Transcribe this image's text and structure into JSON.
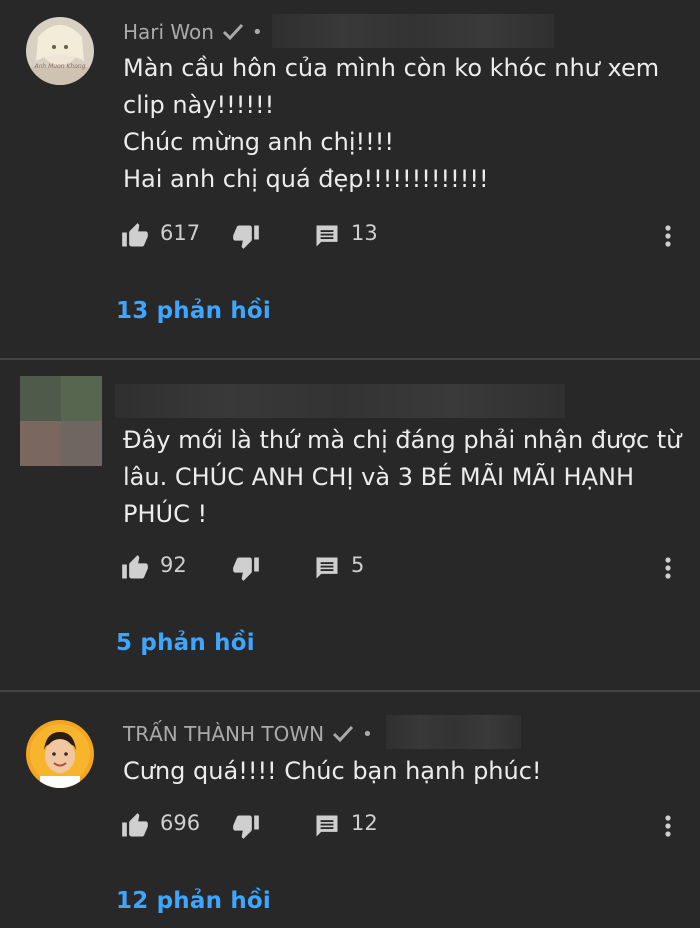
{
  "comments": [
    {
      "author": "Hari Won",
      "verified": true,
      "lines": [
        "Màn cầu hôn của mình còn ko khóc như xem",
        "clip này!!!!!!",
        "Chúc mừng anh chị!!!!",
        "Hai anh chị quá đẹp!!!!!!!!!!!!!"
      ],
      "likes": "617",
      "replies_count": "13",
      "replies_label": "13 phản hồi",
      "avatar_text": "Anh Muon Khong"
    },
    {
      "author": "",
      "verified": false,
      "lines": [
        "Đây mới là thứ mà chị đáng phải nhận được từ",
        "lâu. CHÚC ANH CHỊ và 3 BÉ MÃI MÃI HẠNH",
        "PHÚC  !"
      ],
      "likes": "92",
      "replies_count": "5",
      "replies_label": "5 phản hồi"
    },
    {
      "author": "TRẤN THÀNH TOWN",
      "verified": true,
      "lines": [
        "Cưng quá!!!! Chúc bạn hạnh phúc!"
      ],
      "likes": "696",
      "replies_count": "12",
      "replies_label": "12 phản hồi"
    }
  ],
  "colors": {
    "background": "#282828",
    "link": "#3ea6ff",
    "meta": "#aaaaaa"
  },
  "icons": {
    "like": "thumbs-up-icon",
    "dislike": "thumbs-down-icon",
    "reply": "comment-icon",
    "more": "more-vertical-icon",
    "verified": "checkmark-icon"
  }
}
